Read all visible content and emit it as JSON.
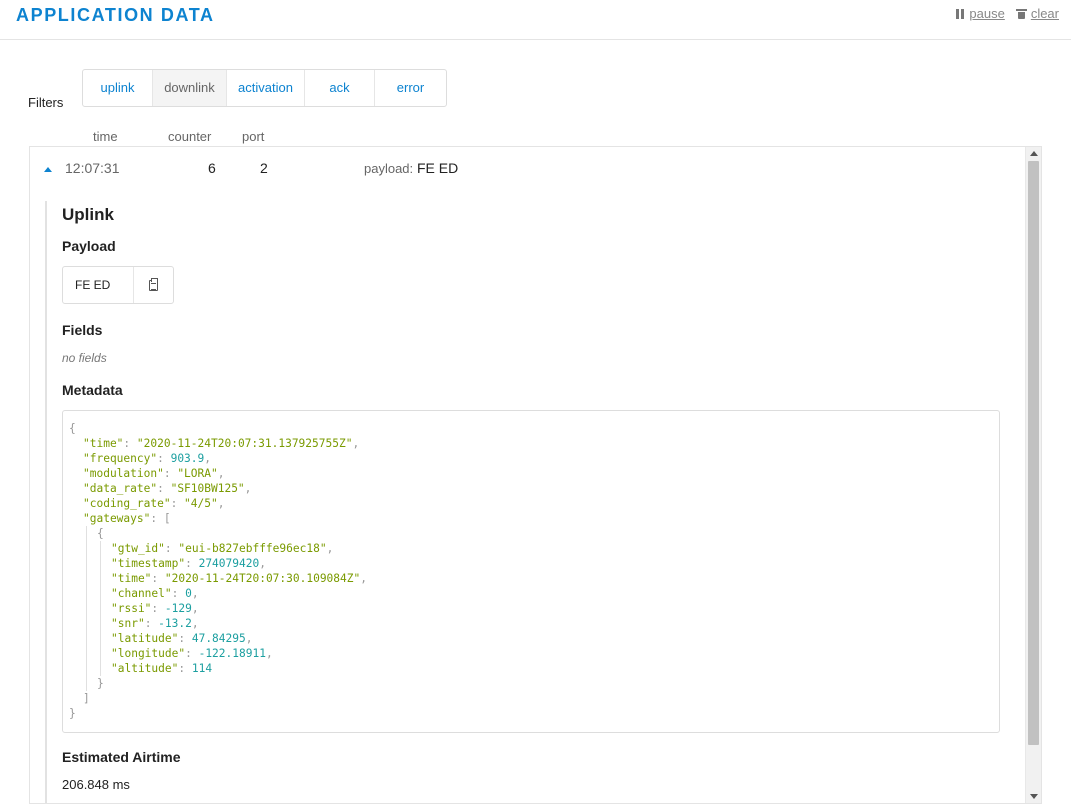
{
  "header": {
    "title": "APPLICATION DATA",
    "pause_label": "pause",
    "clear_label": "clear",
    "pause_icon": "pause-icon",
    "clear_icon": "trash-icon"
  },
  "filters": {
    "label": "Filters",
    "tabs": [
      {
        "label": "uplink",
        "active": false
      },
      {
        "label": "downlink",
        "active": true
      },
      {
        "label": "activation",
        "active": false
      },
      {
        "label": "ack",
        "active": false
      },
      {
        "label": "error",
        "active": false
      }
    ]
  },
  "columns": {
    "time": "time",
    "counter": "counter",
    "port": "port"
  },
  "message": {
    "time": "12:07:31",
    "counter": "6",
    "port": "2",
    "payload_label": "payload:",
    "payload_value": "FE ED",
    "details": {
      "title": "Uplink",
      "payload_heading": "Payload",
      "payload_hex": "FE ED",
      "fields_heading": "Fields",
      "fields_empty": "no fields",
      "metadata_heading": "Metadata",
      "airtime_heading": "Estimated Airtime",
      "airtime_value": "206.848 ms"
    }
  },
  "metadata": {
    "time": "2020-11-24T20:07:31.137925755Z",
    "frequency": 903.9,
    "modulation": "LORA",
    "data_rate": "SF10BW125",
    "coding_rate": "4/5",
    "gateways": [
      {
        "gtw_id": "eui-b827ebfffe96ec18",
        "timestamp": 274079420,
        "time": "2020-11-24T20:07:30.109084Z",
        "channel": 0,
        "rssi": -129,
        "snr": -13.2,
        "latitude": 47.84295,
        "longitude": -122.18911,
        "altitude": 114
      }
    ]
  },
  "colors": {
    "accent": "#0d83d0",
    "json_string": "#7a9a00",
    "json_number": "#1c9fa0"
  }
}
